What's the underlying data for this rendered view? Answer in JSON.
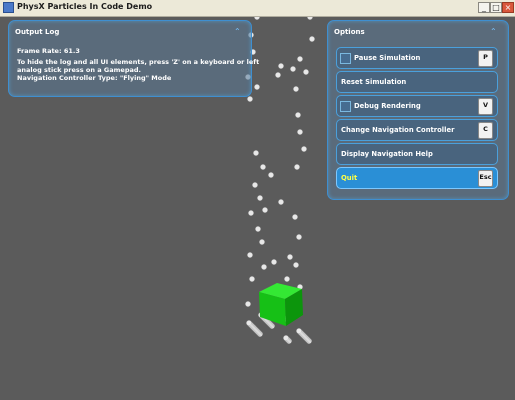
{
  "window": {
    "title": "PhysX Particles In Code Demo",
    "minimize_glyph": "_",
    "maximize_glyph": "□",
    "close_glyph": "×"
  },
  "output_log": {
    "title": "Output Log",
    "collapse_glyph": "⌃",
    "lines": [
      "Frame Rate: 61.3",
      "To hide the log and all UI elements, press 'Z' on a keyboard or left",
      "analog stick press on a Gamepad.",
      "Navigation Controller Type: \"Flying\" Mode"
    ]
  },
  "options": {
    "title": "Options",
    "collapse_glyph": "⌃",
    "items": [
      {
        "label": "Pause Simulation",
        "checkbox": true,
        "key": "P"
      },
      {
        "label": "Reset Simulation",
        "checkbox": false,
        "key": ""
      },
      {
        "label": "Debug Rendering",
        "checkbox": true,
        "key": "V"
      },
      {
        "label": "Change Navigation Controller",
        "checkbox": false,
        "key": "C"
      },
      {
        "label": "Display Navigation Help",
        "checkbox": false,
        "key": ""
      },
      {
        "label": "Quit",
        "checkbox": false,
        "key": "Esc"
      }
    ]
  },
  "scene": {
    "background_color": "#5b5b5b",
    "cube_color": "#1fd21f",
    "particle_color": "#e8e8e8"
  }
}
